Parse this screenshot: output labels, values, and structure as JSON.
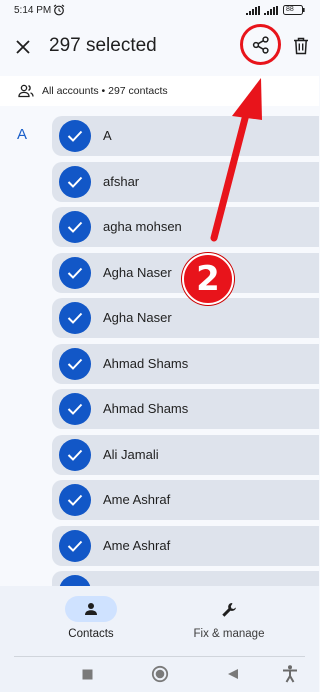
{
  "status_bar": {
    "time": "5:14 PM",
    "battery": "88"
  },
  "top_bar": {
    "title": "297 selected"
  },
  "account_filter": {
    "text": "All accounts • 297 contacts"
  },
  "section": {
    "letter": "A"
  },
  "contacts": [
    {
      "name": "A"
    },
    {
      "name": "afshar"
    },
    {
      "name": "agha mohsen"
    },
    {
      "name": "Agha Naser"
    },
    {
      "name": "Agha Naser"
    },
    {
      "name": "Ahmad Shams"
    },
    {
      "name": "Ahmad Shams"
    },
    {
      "name": "Ali Jamali"
    },
    {
      "name": "Ame Ashraf"
    },
    {
      "name": "Ame Ashraf"
    },
    {
      "name": ""
    }
  ],
  "bottom_nav": {
    "contacts_label": "Contacts",
    "fix_manage_label": "Fix & manage"
  },
  "annotation": {
    "step_number": "2",
    "color": "#e8141b"
  },
  "colors": {
    "accent": "#1257c7",
    "selected_row": "#dee3ec"
  }
}
